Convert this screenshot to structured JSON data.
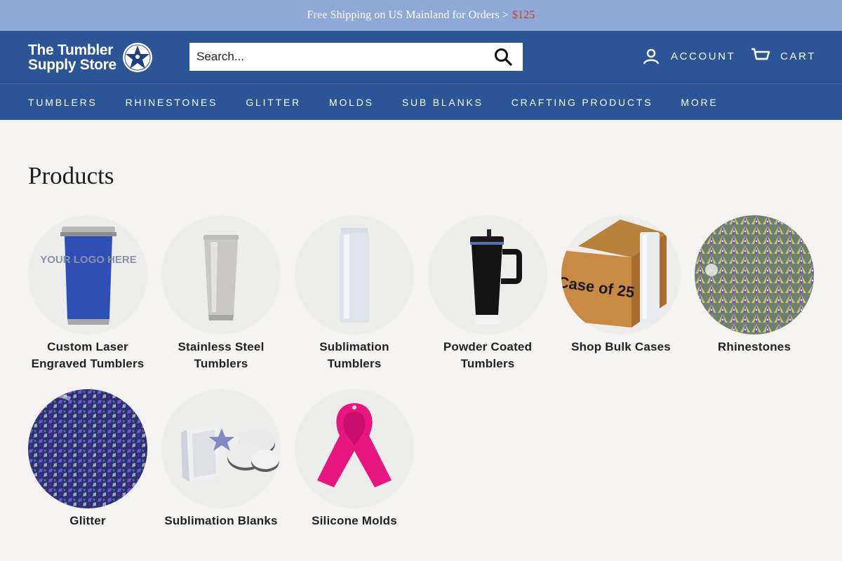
{
  "announcement": {
    "text": "Free Shipping on US Mainland for Orders >",
    "price": "$125"
  },
  "header": {
    "logo_line1": "The Tumbler",
    "logo_line2": "Supply Store",
    "search_placeholder": "Search...",
    "account_label": "ACCOUNT",
    "cart_label": "CART"
  },
  "nav": {
    "items": [
      {
        "label": "TUMBLERS"
      },
      {
        "label": "RHINESTONES"
      },
      {
        "label": "GLITTER"
      },
      {
        "label": "MOLDS"
      },
      {
        "label": "SUB BLANKS"
      },
      {
        "label": "CRAFTING PRODUCTS"
      },
      {
        "label": "MORE"
      }
    ]
  },
  "main": {
    "title": "Products",
    "products": [
      {
        "title": "Custom Laser Engraved Tumblers",
        "image_text": "YOUR LOGO HERE"
      },
      {
        "title": "Stainless Steel Tumblers"
      },
      {
        "title": "Sublimation Tumblers"
      },
      {
        "title": "Powder Coated Tumblers"
      },
      {
        "title": "Shop Bulk Cases",
        "image_text": "Case of 25"
      },
      {
        "title": "Rhinestones"
      },
      {
        "title": "Glitter"
      },
      {
        "title": "Sublimation Blanks"
      },
      {
        "title": "Silicone Molds"
      }
    ]
  },
  "colors": {
    "header_bg": "#2c5496",
    "announce_bg": "#8fa9d6",
    "price_red": "#d33a2c",
    "page_bg": "#f4f3f1"
  }
}
